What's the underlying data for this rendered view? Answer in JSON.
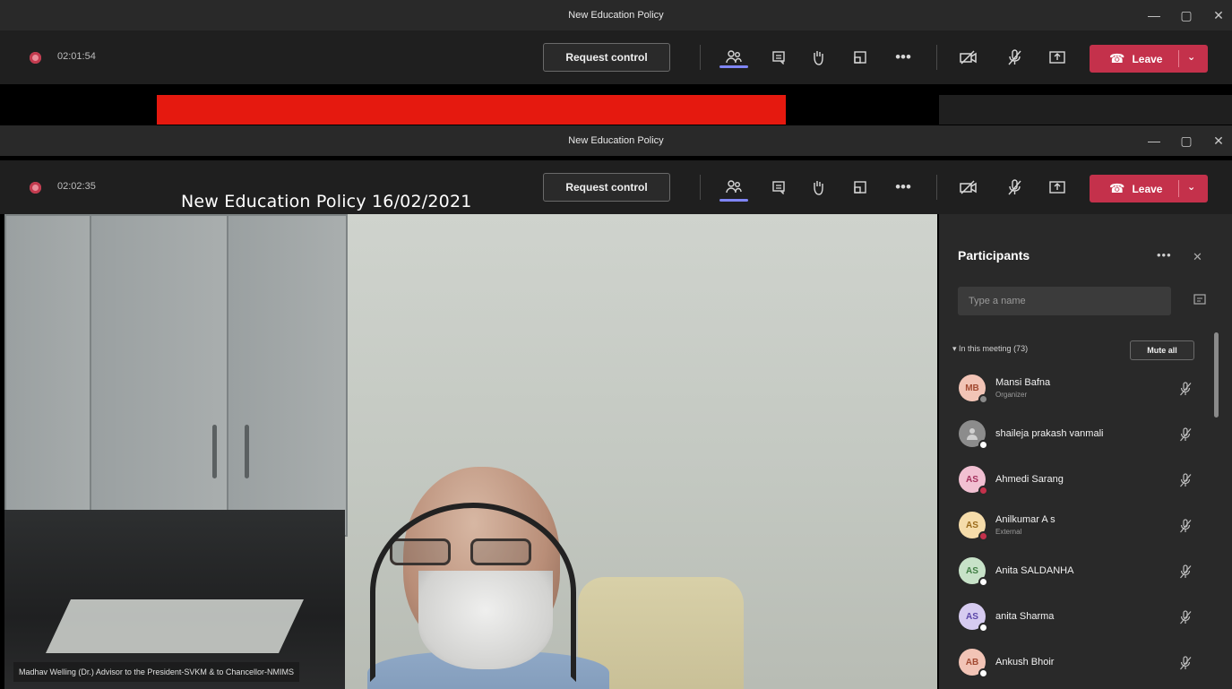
{
  "window": {
    "title": "New Education Policy",
    "controls": {
      "minimize": "—",
      "maximize": "▢",
      "close": "✕"
    }
  },
  "toolbar_top": {
    "timer": "02:01:54"
  },
  "toolbar_bottom": {
    "timer": "02:02:35"
  },
  "toolbar": {
    "request_control": "Request control",
    "leave": "Leave",
    "icons": {
      "participants": "people-icon",
      "chat": "chat-icon",
      "raise_hand": "raise-hand-icon",
      "rooms": "rooms-icon",
      "more": "more-icon",
      "camera": "camera-off-icon",
      "mic": "mic-off-icon",
      "share": "share-screen-icon",
      "hangup": "phone-hangup-icon"
    },
    "accent": "#c4314b"
  },
  "overlay_title": "New Education Policy 16/02/2021",
  "video": {
    "speaker_caption": "Madhav Welling (Dr.) Advisor to the President-SVKM & to Chancellor-NMIMS"
  },
  "participants": {
    "title": "Participants",
    "more": "•••",
    "close": "✕",
    "search_placeholder": "Type a name",
    "section_label": "In this meeting (73)",
    "mute_all": "Mute all",
    "list": [
      {
        "initials": "MB",
        "name": "Mansi Bafna",
        "role": "Organizer",
        "avatar_bg": "#f2c4b6",
        "avatar_fg": "#a24a32",
        "presence": "#8a8a8a"
      },
      {
        "initials": "",
        "name": "shaileja prakash vanmali",
        "role": "",
        "avatar_bg": "#8c8c8c",
        "avatar_fg": "#d9d9d9",
        "presence": "#ffffff"
      },
      {
        "initials": "AS",
        "name": "Ahmedi Sarang",
        "role": "",
        "avatar_bg": "#f1c0d2",
        "avatar_fg": "#a3315d",
        "presence": "#c4314b"
      },
      {
        "initials": "AS",
        "name": "Anilkumar A s",
        "role": "External",
        "avatar_bg": "#f5dcaa",
        "avatar_fg": "#9a6a1a",
        "presence": "#c4314b"
      },
      {
        "initials": "AS",
        "name": "Anita SALDANHA",
        "role": "",
        "avatar_bg": "#c7e2c8",
        "avatar_fg": "#3f7d43",
        "presence": "#ffffff"
      },
      {
        "initials": "AS",
        "name": "anita Sharma",
        "role": "",
        "avatar_bg": "#d6cbf0",
        "avatar_fg": "#5b46a8",
        "presence": "#ffffff"
      },
      {
        "initials": "AB",
        "name": "Ankush Bhoir",
        "role": "",
        "avatar_bg": "#f2c4b6",
        "avatar_fg": "#a24a32",
        "presence": "#ffffff"
      }
    ]
  }
}
